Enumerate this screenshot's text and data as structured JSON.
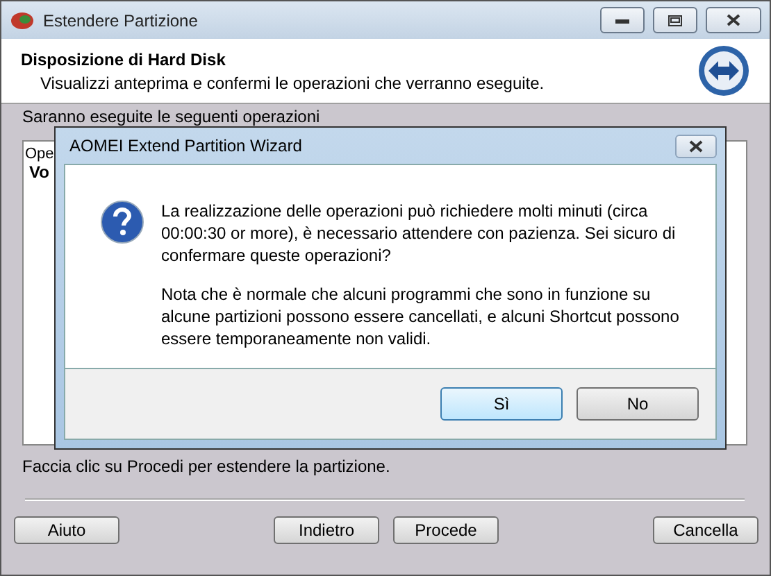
{
  "window": {
    "title": "Estendere Partizione",
    "controls": [
      {
        "kind": "minimize"
      },
      {
        "kind": "maximize"
      },
      {
        "kind": "close"
      }
    ]
  },
  "header": {
    "title": "Disposizione di Hard Disk",
    "subtitle": "Visualizzi anteprima e confermi le operazioni che verranno eseguite."
  },
  "operations_label": "Saranno eseguite le seguenti operazioni",
  "operations_list": [
    {
      "text": "Ope",
      "bold": false
    },
    {
      "text": "Vo",
      "bold": true
    }
  ],
  "hint": "Faccia clic su Procedi per estendere la partizione.",
  "button_groups": [
    [
      "Aiuto"
    ],
    [
      "Indietro",
      "Procede"
    ],
    [
      "Cancella"
    ]
  ],
  "dialog": {
    "title": "AOMEI Extend Partition Wizard",
    "paragraphs": [
      "La realizzazione delle operazioni può richiedere molti minuti (circa 00:00:30 or more), è necessario attendere con pazienza. Sei sicuro di confermare queste operazioni?",
      "Nota che è normale che alcuni programmi che sono in funzione su alcune partizioni possono essere cancellati, e alcuni Shortcut possono essere temporaneamente non validi."
    ],
    "buttons": [
      {
        "label": "Sì",
        "hovered": true
      },
      {
        "label": "No",
        "hovered": false
      }
    ]
  }
}
